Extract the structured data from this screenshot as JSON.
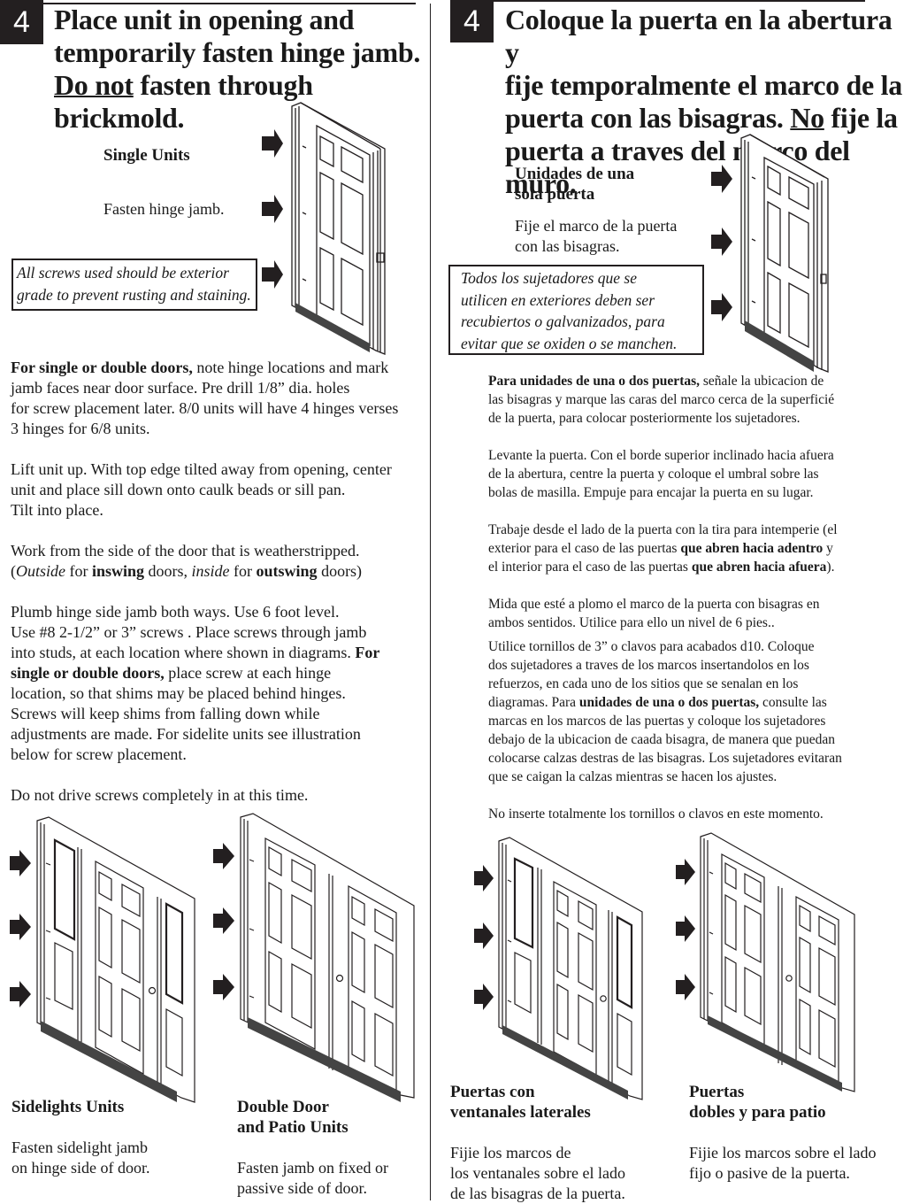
{
  "english": {
    "step_number": "4",
    "heading": {
      "line1": "Place unit in opening and",
      "line2": "temporarily fasten hinge jamb.",
      "line3_underlined": "Do not",
      "line3_rest": " fasten through brickmold."
    },
    "single_units": {
      "title": "Single Units",
      "instruction": "Fasten hinge jamb."
    },
    "note": {
      "line1": "All screws used should be exterior",
      "line2": "grade to prevent rusting and staining."
    },
    "paragraphs": {
      "p1_bold": "For single or double doors,",
      "p1_l1_rest": " note hinge locations and mark",
      "p1_l2": "jamb faces near door surface. Pre drill 1/8” dia. holes",
      "p1_l3": "for screw placement later. 8/0 units will have 4 hinges verses",
      "p1_l4": "3 hinges for 6/8 units.",
      "p2_l1": "Lift unit up. With top edge tilted away from opening, center",
      "p2_l2": "unit and place sill down onto caulk beads or sill pan.",
      "p2_l3": "Tilt into place.",
      "p3_l1": "Work from the side of the door that is weatherstripped.",
      "p3_open": "(",
      "p3_outside": "Outside",
      "p3_for1": " for ",
      "p3_inswing": "inswing",
      "p3_doors1": " doors, ",
      "p3_inside": "inside",
      "p3_for2": " for ",
      "p3_outswing": "outswing",
      "p3_doors2": " doors)",
      "p4_l1": "Plumb hinge side jamb both ways. Use 6 foot level.",
      "p4_l2": "Use #8 2-1/2” or 3” screws . Place screws through jamb",
      "p4_l3_a": "into studs, at each location where shown in diagrams. ",
      "p4_l3_bold": "For",
      "p4_l4_bold": "single or double doors,",
      "p4_l4_rest": " place screw at each hinge",
      "p4_l5": "location, so that shims may be placed behind hinges.",
      "p4_l6": "Screws will keep shims from falling down while",
      "p4_l7": "adjustments are made. For sidelite units see illustration",
      "p4_l8": "below for screw placement.",
      "p5": "Do not drive screws completely in at this time."
    },
    "sidelights": {
      "title": "Sidelights Units",
      "line1": "Fasten sidelight jamb",
      "line2": "on hinge side of door."
    },
    "double_door": {
      "title_line1": "Double Door",
      "title_line2": "and Patio Units",
      "line1": "Fasten jamb on fixed or",
      "line2": "passive side of door."
    }
  },
  "spanish": {
    "step_number": "4",
    "heading": {
      "line1": "Coloque la puerta en la abertura y",
      "line2": "fije temporalmente el marco de la",
      "line3_a": "puerta con las bisagras. ",
      "line3_underlined": "No",
      "line3_b": " fije la",
      "line4": "puerta a traves del marco del muro."
    },
    "single_units": {
      "title_line1": "Unidades de una",
      "title_line2": "sola puerta",
      "line1": "Fije el marco de la puerta",
      "line2": "con las bisagras."
    },
    "note": {
      "line1": "Todos los sujetadores que se",
      "line2": "utilicen en exteriores deben ser",
      "line3": "recubiertos o galvanizados, para",
      "line4": "evitar que se oxiden o se manchen."
    },
    "paragraphs": {
      "p1_bold": "Para unidades de una o dos puertas,",
      "p1_l1_rest": " señale la ubicacion de",
      "p1_l2": "las bisagras y marque las caras del marco cerca de la superficié",
      "p1_l3": "de la puerta, para colocar posteriormente los sujetadores.",
      "p2_l1": "Levante la puerta. Con el borde superior inclinado hacia afuera",
      "p2_l2": "de la abertura, centre la puerta y coloque el umbral sobre las",
      "p2_l3": "bolas de masilla. Empuje para encajar la puerta en su lugar.",
      "p3_l1": "Trabaje desde el lado de la puerta con la tira para intemperie (el",
      "p3_l2_a": "exterior para el caso de las puertas ",
      "p3_l2_bold": "que abren hacia adentro",
      "p3_l2_b": " y",
      "p3_l3_a": "el interior para el caso de las puertas ",
      "p3_l3_bold": "que abren hacia afuera",
      "p3_l3_b": ").",
      "p4_l1": "Mida que esté a plomo el marco de la puerta con bisagras en",
      "p4_l2": "ambos sentidos. Utilice para ello un nivel de 6 pies..",
      "p5_l1": "Utilice tornillos de 3” o clavos para acabados d10. Coloque",
      "p5_l2": "dos sujetadores a traves de los marcos insertandolos en los",
      "p5_l3": "refuerzos, en cada uno de los sitios que se senalan en los",
      "p5_l4_a": "diagramas. Para ",
      "p5_l4_bold": "unidades de una o dos puertas,",
      "p5_l4_b": " consulte las",
      "p5_l5": "marcas en los marcos de las puertas y coloque los sujetadores",
      "p5_l6": "debajo de la ubicacion de caada bisagra, de manera que puedan",
      "p5_l7": "colocarse calzas destras de las bisagras. Los sujetadores evitaran",
      "p5_l8": " que se caigan la calzas mientras se hacen los ajustes.",
      "p6": "No inserte totalmente los tornillos o clavos en este momento."
    },
    "sidelights": {
      "title_line1": "Puertas con",
      "title_line2": "ventanales laterales",
      "line1": "Fijie los marcos de",
      "line2": "los ventanales sobre el lado",
      "line3": "de las bisagras de la puerta."
    },
    "double_door": {
      "title_line1": "Puertas",
      "title_line2": "dobles y para patio",
      "line1": "Fijie los marcos sobre el lado",
      "line2": "fijo o pasive de la puerta."
    }
  },
  "illustrations": {
    "single_door": "single six-panel door with frame and 3 fastening arrows",
    "sidelight_unit": "door with sidelights and 3 fastening arrows",
    "double_door_unit": "double door / patio unit and 3 fastening arrows",
    "arrow_icon": "right-pointing fastening arrow"
  }
}
